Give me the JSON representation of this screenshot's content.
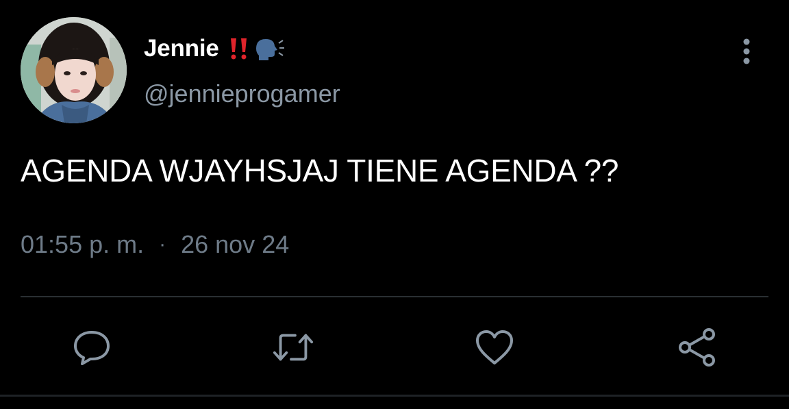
{
  "tweet": {
    "author": {
      "display_name": "Jennie",
      "name_emojis": [
        "double-exclamation-icon",
        "speaking-head-icon"
      ],
      "handle": "@jennieprogamer",
      "avatar": "profile-photo"
    },
    "text": "AGENDA WJAYHSJAJ TIENE AGENDA ??",
    "time": "01:55 p. m.",
    "separator": "·",
    "date": "26 nov 24",
    "actions": [
      {
        "name": "reply",
        "icon": "comment-icon"
      },
      {
        "name": "retweet",
        "icon": "retweet-icon"
      },
      {
        "name": "like",
        "icon": "heart-icon"
      },
      {
        "name": "share",
        "icon": "share-icon"
      }
    ],
    "menu_icon": "more-vertical-icon"
  },
  "colors": {
    "background": "#000000",
    "primary_text": "#ffffff",
    "secondary_text": "#8b98a5",
    "icon": "#8b98a5",
    "divider": "#2a2f33",
    "accent_red": "#e0242b",
    "accent_blue": "#4a6f9c"
  }
}
